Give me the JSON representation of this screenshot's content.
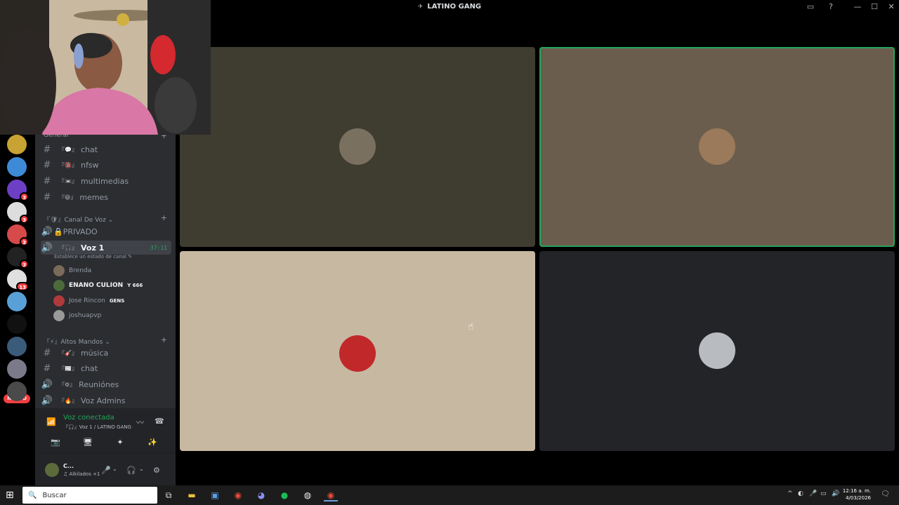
{
  "window": {
    "title": "LATINO GANG",
    "controls": {
      "inbox": "▭",
      "help": "?",
      "minimize": "—",
      "maximize": "☐",
      "close": "✕"
    }
  },
  "servers": [
    {
      "color": "#c8a232",
      "badge": ""
    },
    {
      "color": "#3d8bd6",
      "badge": ""
    },
    {
      "color": "#6c3fc4",
      "badge": "3"
    },
    {
      "color": "#dddddd",
      "badge": "3"
    },
    {
      "color": "#d64a4a",
      "badge": "3"
    },
    {
      "color": "#222222",
      "badge": "3"
    },
    {
      "color": "#e0e0e0",
      "badge": "13"
    },
    {
      "color": "#5aa0d8",
      "badge": ""
    },
    {
      "color": "#111111",
      "badge": ""
    },
    {
      "color": "#3a5b7a",
      "badge": ""
    },
    {
      "color": "#7a7a8a",
      "badge": ""
    },
    {
      "color": "#4a4a4a",
      "badge": ""
    }
  ],
  "nuevo_label": "NUEVO",
  "sidebar": {
    "category_general": "General",
    "text_channels": [
      {
        "emoji": "💬",
        "label": "chat"
      },
      {
        "emoji": "🔞",
        "label": "nfsw"
      },
      {
        "emoji": "📼",
        "label": "multimedias"
      },
      {
        "emoji": "😆",
        "label": "memes"
      }
    ],
    "category_voz": "Canal De Voz",
    "private_channel": "🔒PRIVADO",
    "active_voice": {
      "label": "Voz 1",
      "timer": "37:11",
      "status": "Establece un estado de canal ✎"
    },
    "voice_users": [
      {
        "name": "Brenda",
        "tag": "",
        "color": "#7a6a5a",
        "bold": false
      },
      {
        "name": "ENANO CULION",
        "tag": "Y 666",
        "color": "#4d6b3a",
        "bold": true
      },
      {
        "name": "Jose Rincon",
        "tag": "GENS",
        "color": "#b03a3a",
        "bold": false
      },
      {
        "name": "joshuapvp",
        "tag": "",
        "color": "#999999",
        "bold": false
      }
    ],
    "category_altos": "Altos Mandos",
    "lower_channels": [
      {
        "icon": "#",
        "emoji": "🎸",
        "label": "música"
      },
      {
        "icon": "#",
        "emoji": "📰",
        "label": "chat"
      },
      {
        "icon": "🔊",
        "emoji": "⚙",
        "label": "Reuniónes"
      },
      {
        "icon": "🔊",
        "emoji": "🔥",
        "label": "Voz Admins"
      }
    ]
  },
  "voice_panel": {
    "title": "Voz conectada",
    "subtitle": "『🎧』Voz 1 / LATINO GANG",
    "buttons": [
      "📷",
      "🖥",
      "✦",
      "✨"
    ]
  },
  "user_panel": {
    "name": "C...",
    "status": "♫ Alkilados +1"
  },
  "tiles": [
    {
      "bg": "#3f3c30",
      "avatar": "#7a7060",
      "speaking": false
    },
    {
      "bg": "#6b5d4d",
      "avatar": "#9a7a5a",
      "speaking": true
    },
    {
      "bg": "#c7b8a2",
      "avatar": "#c0282a",
      "speaking": false
    },
    {
      "bg": "#232428",
      "avatar": "#b8bcc0",
      "speaking": false
    }
  ],
  "taskbar": {
    "search_placeholder": "Buscar",
    "time": "12:16 a. m.",
    "date": "4/03/2026"
  }
}
